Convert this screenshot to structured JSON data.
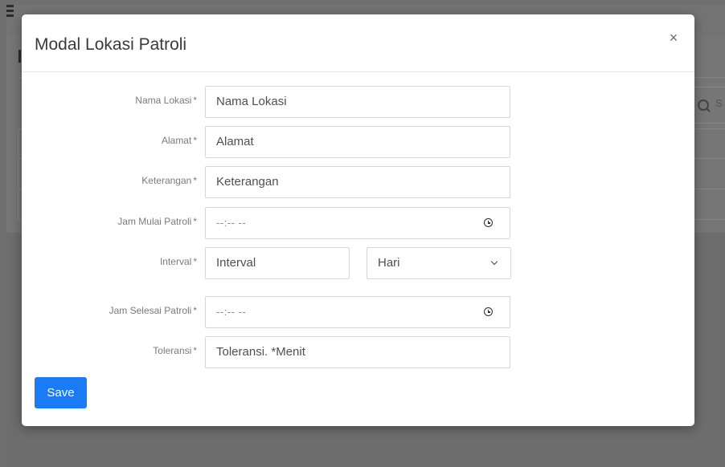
{
  "modal": {
    "title": "Modal Lokasi Patroli",
    "close_label": "×",
    "fields": {
      "nama_lokasi": {
        "label": "Nama Lokasi",
        "required_mark": "*",
        "placeholder": "Nama Lokasi"
      },
      "alamat": {
        "label": "Alamat",
        "required_mark": "*",
        "placeholder": "Alamat"
      },
      "keterangan": {
        "label": "Keterangan",
        "required_mark": "*",
        "placeholder": "Keterangan"
      },
      "jam_mulai": {
        "label": "Jam Mulai Patroli",
        "required_mark": "*",
        "placeholder": "--:-- --",
        "icon": "clock-icon"
      },
      "interval": {
        "label": "Interval",
        "required_mark": "*",
        "placeholder": "Interval",
        "select_value": "Hari",
        "select_icon": "chevron-down-icon"
      },
      "jam_selesai": {
        "label": "Jam Selesai Patroli",
        "required_mark": "*",
        "placeholder": "--:-- --",
        "icon": "clock-icon"
      },
      "toleransi": {
        "label": "Toleransi",
        "required_mark": "*",
        "placeholder": "Toleransi. *Menit"
      }
    },
    "save_label": "Save"
  },
  "background": {
    "search_fragment": "S"
  },
  "colors": {
    "primary": "#1a7cf4",
    "overlay": "#6f6f6f"
  }
}
